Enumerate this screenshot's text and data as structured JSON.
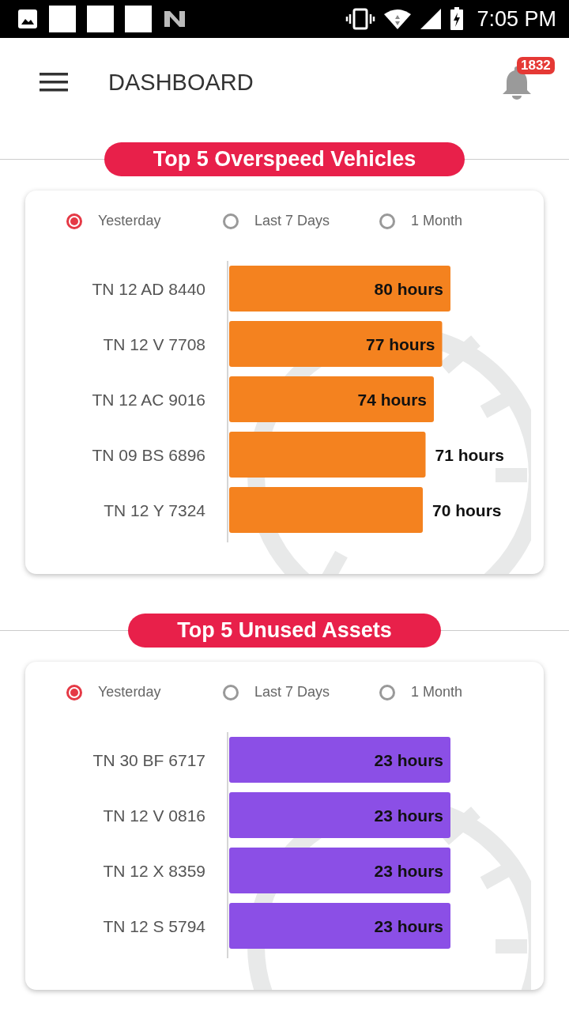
{
  "status_bar": {
    "time": "7:05 PM"
  },
  "header": {
    "title": "DASHBOARD",
    "notification_count": "1832"
  },
  "sections": [
    {
      "title": "Top 5 Overspeed Vehicles",
      "filters": [
        {
          "label": "Yesterday",
          "selected": true
        },
        {
          "label": "Last 7 Days",
          "selected": false
        },
        {
          "label": "1 Month",
          "selected": false
        }
      ],
      "chart_data": {
        "type": "bar",
        "orientation": "horizontal",
        "data_labels": true,
        "categories": [
          "TN 12 AD 8440",
          "TN 12 V 7708",
          "TN 12 AC 9016",
          "TN 09 BS 6896",
          "TN 12 Y 7324"
        ],
        "series": [
          {
            "color": "#f4821f",
            "values": [
              80,
              77,
              74,
              71,
              70
            ]
          }
        ]
      },
      "value_units": [
        "hours",
        "hours",
        "hours",
        "hours",
        "hours"
      ]
    },
    {
      "title": "Top 5 Unused Assets",
      "filters": [
        {
          "label": "Yesterday",
          "selected": true
        },
        {
          "label": "Last 7 Days",
          "selected": false
        },
        {
          "label": "1 Month",
          "selected": false
        }
      ],
      "chart_data": {
        "type": "bar",
        "orientation": "horizontal",
        "data_labels": true,
        "categories": [
          "TN 30 BF 6717",
          "TN 12 V 0816",
          "TN 12 X 8359",
          "TN 12 S 5794"
        ],
        "series": [
          {
            "color": "#8b4fe6",
            "values": [
              23,
              23,
              23,
              23
            ]
          }
        ]
      },
      "value_units": [
        "hours",
        "hours",
        "hours",
        "hours"
      ]
    }
  ]
}
